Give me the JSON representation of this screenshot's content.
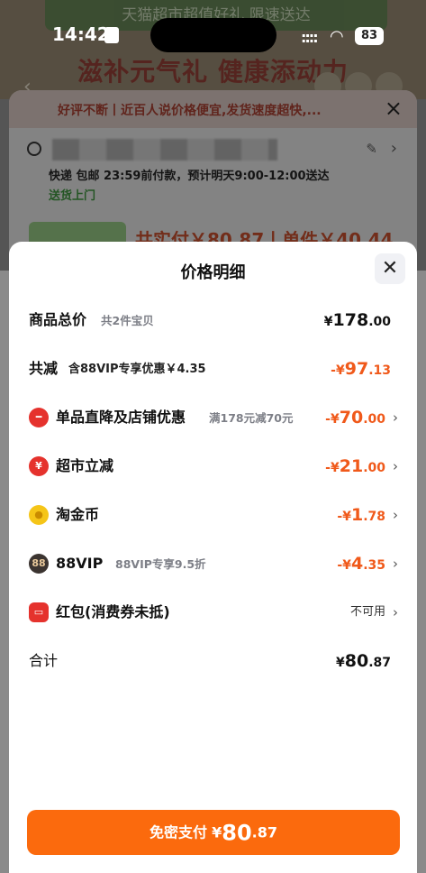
{
  "status_bar": {
    "time": "14:42",
    "signal": "::::",
    "battery": "83"
  },
  "background": {
    "banner_top": "天猫超市超值好礼 限速送达",
    "slogan": "滋补元气礼 健康添动力",
    "notice": "好评不断丨近百人说价格便宜,发货速度超快,...",
    "shipping_line": "快递 包邮  23:59前付款，预计明天9:00-12:00送达",
    "shipping_tag": "送货上门",
    "product_price": "共实付￥80.87丨单件￥40.44"
  },
  "sheet": {
    "title": "价格明细",
    "rows": [
      {
        "label": "商品总价",
        "sub": "共2件宝贝",
        "yen": "¥",
        "int": "178",
        "dec": ".00",
        "color": "#111111",
        "chevron": false
      },
      {
        "label": "共减",
        "sub": "含88VIP专享优惠￥4.35",
        "yen": "-¥",
        "int": "97",
        "dec": ".13",
        "color": "#f0591a",
        "chevron": false
      },
      {
        "label": "单品直降及店铺优惠",
        "sub": "满178元减70元",
        "yen": "-¥",
        "int": "70",
        "dec": ".00",
        "color": "#f0591a",
        "chevron": true,
        "icon": "minus-circle-icon"
      },
      {
        "label": "超市立减",
        "sub": "",
        "yen": "-¥",
        "int": "21",
        "dec": ".00",
        "color": "#f0591a",
        "chevron": true,
        "icon": "yuan-coin-icon"
      },
      {
        "label": "淘金币",
        "sub": "",
        "yen": "-¥",
        "int": "1",
        "dec": ".78",
        "color": "#f0591a",
        "chevron": true,
        "icon": "gold-coin-icon"
      },
      {
        "label": "88VIP",
        "sub": "88VIP专享9.5折",
        "yen": "-¥",
        "int": "4",
        "dec": ".35",
        "color": "#f0591a",
        "chevron": true,
        "icon": "vip-88-icon"
      },
      {
        "label": "红包(消费券未抵)",
        "sub": "",
        "unavailable": "不可用",
        "chevron": true,
        "icon": "red-envelope-icon"
      },
      {
        "label": "合计",
        "sub": "",
        "yen": "¥",
        "int": "80",
        "dec": ".87",
        "color": "#111111",
        "chevron": false
      }
    ],
    "pay_button": {
      "label": "免密支付",
      "yen": "¥",
      "int": "80",
      "dec": ".87"
    }
  },
  "icons": {
    "close": "close-icon",
    "chevron": "chevron-right-icon",
    "back": "back-arrow-icon"
  }
}
